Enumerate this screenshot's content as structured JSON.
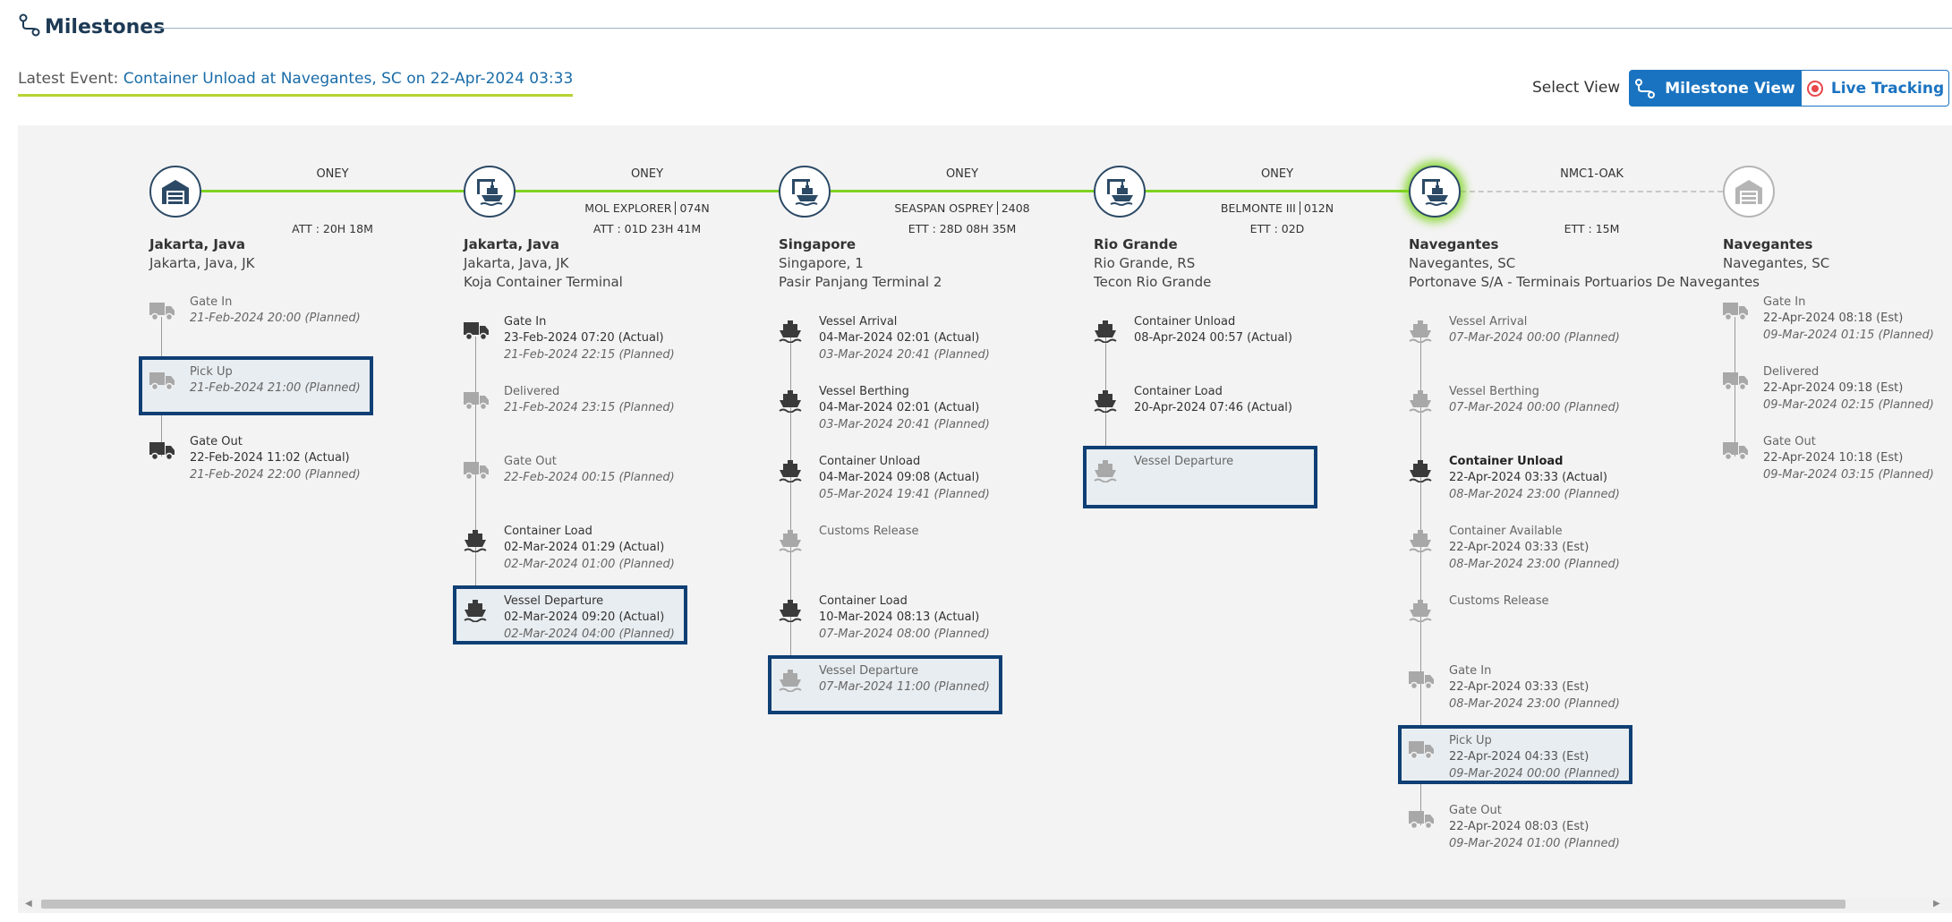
{
  "header": {
    "title": "Milestones",
    "icon": "route-icon"
  },
  "latest_event": {
    "label": "Latest Event:",
    "value": "Container Unload at Navegantes, SC on 22-Apr-2024 03:33"
  },
  "view_selector": {
    "label": "Select View",
    "milestone_label": "Milestone View",
    "live_label": "Live Tracking",
    "active": "Milestone View"
  },
  "colors": {
    "accent": "#1a73c0",
    "route_done": "#7ed321",
    "highlight_border": "#0f3f74",
    "node_border": "#2c4a66"
  },
  "legs": [
    {
      "carrier": "ONEY",
      "vessel": "",
      "voyage": "",
      "eta": "ATT : 20H 18M",
      "status": "done"
    },
    {
      "carrier": "ONEY",
      "vessel": "MOL EXPLORER",
      "voyage": "074N",
      "eta": "ATT : 01D 23H 41M",
      "status": "done"
    },
    {
      "carrier": "ONEY",
      "vessel": "SEASPAN OSPREY",
      "voyage": "2408",
      "eta": "ETT : 28D 08H 35M",
      "status": "done"
    },
    {
      "carrier": "ONEY",
      "vessel": "BELMONTE III",
      "voyage": "012N",
      "eta": "ETT : 02D",
      "status": "done"
    },
    {
      "carrier": "NMC1-OAK",
      "vessel": "",
      "voyage": "",
      "eta": "ETT : 15M",
      "status": "future"
    }
  ],
  "locations": [
    {
      "icon": "warehouse-icon",
      "state": "past",
      "name": "Jakarta, Java",
      "sub": "Jakarta, Java, JK",
      "terminal": "",
      "events": [
        {
          "icon": "truck-icon",
          "title": "Gate In",
          "lines": [
            "21-Feb-2024 20:00 (Planned)"
          ],
          "kind": "planned",
          "highlight": false
        },
        {
          "icon": "truck-icon",
          "title": "Pick Up",
          "lines": [
            "21-Feb-2024 21:00 (Planned)"
          ],
          "kind": "planned",
          "highlight": true
        },
        {
          "icon": "truck-icon",
          "title": "Gate Out",
          "lines": [
            "22-Feb-2024 11:02 (Actual)",
            "21-Feb-2024 22:00 (Planned)"
          ],
          "kind": "actual",
          "highlight": false
        }
      ]
    },
    {
      "icon": "crane-icon",
      "state": "past",
      "name": "Jakarta, Java",
      "sub": "Jakarta, Java, JK",
      "terminal": "Koja Container Terminal",
      "events": [
        {
          "icon": "truck-icon",
          "title": "Gate In",
          "lines": [
            "23-Feb-2024 07:20 (Actual)",
            "21-Feb-2024 22:15 (Planned)"
          ],
          "kind": "actual",
          "highlight": false
        },
        {
          "icon": "truck-icon",
          "title": "Delivered",
          "lines": [
            "21-Feb-2024 23:15 (Planned)"
          ],
          "kind": "planned",
          "highlight": false
        },
        {
          "icon": "truck-icon",
          "title": "Gate Out",
          "lines": [
            "22-Feb-2024 00:15 (Planned)"
          ],
          "kind": "planned",
          "highlight": false
        },
        {
          "icon": "ship-icon",
          "title": "Container Load",
          "lines": [
            "02-Mar-2024 01:29 (Actual)",
            "02-Mar-2024 01:00 (Planned)"
          ],
          "kind": "actual",
          "highlight": false
        },
        {
          "icon": "ship-icon",
          "title": "Vessel Departure",
          "lines": [
            "02-Mar-2024 09:20 (Actual)",
            "02-Mar-2024 04:00 (Planned)"
          ],
          "kind": "actual",
          "highlight": true
        }
      ]
    },
    {
      "icon": "crane-icon",
      "state": "past",
      "name": "Singapore",
      "sub": "Singapore, 1",
      "terminal": "Pasir Panjang Terminal 2",
      "events": [
        {
          "icon": "ship-icon",
          "title": "Vessel Arrival",
          "lines": [
            "04-Mar-2024 02:01 (Actual)",
            "03-Mar-2024 20:41 (Planned)"
          ],
          "kind": "actual",
          "highlight": false
        },
        {
          "icon": "ship-icon",
          "title": "Vessel Berthing",
          "lines": [
            "04-Mar-2024 02:01 (Actual)",
            "03-Mar-2024 20:41 (Planned)"
          ],
          "kind": "actual",
          "highlight": false
        },
        {
          "icon": "ship-icon",
          "title": "Container Unload",
          "lines": [
            "04-Mar-2024 09:08 (Actual)",
            "05-Mar-2024 19:41 (Planned)"
          ],
          "kind": "actual",
          "highlight": false
        },
        {
          "icon": "ship-icon",
          "title": "Customs Release",
          "lines": [],
          "kind": "planned",
          "highlight": false
        },
        {
          "icon": "ship-icon",
          "title": "Container Load",
          "lines": [
            "10-Mar-2024 08:13 (Actual)",
            "07-Mar-2024 08:00 (Planned)"
          ],
          "kind": "actual",
          "highlight": false
        },
        {
          "icon": "ship-icon",
          "title": "Vessel Departure",
          "lines": [
            "07-Mar-2024 11:00 (Planned)"
          ],
          "kind": "planned",
          "highlight": true
        }
      ]
    },
    {
      "icon": "crane-icon",
      "state": "past",
      "name": "Rio Grande",
      "sub": "Rio Grande, RS",
      "terminal": "Tecon Rio Grande",
      "events": [
        {
          "icon": "ship-icon",
          "title": "Container Unload",
          "lines": [
            "08-Apr-2024 00:57 (Actual)"
          ],
          "kind": "actual",
          "highlight": false
        },
        {
          "icon": "ship-icon",
          "title": "Container Load",
          "lines": [
            "20-Apr-2024 07:46 (Actual)"
          ],
          "kind": "actual",
          "highlight": false
        },
        {
          "icon": "ship-icon",
          "title": "Vessel Departure",
          "lines": [],
          "kind": "planned",
          "highlight": true
        }
      ]
    },
    {
      "icon": "crane-icon",
      "state": "current",
      "name": "Navegantes",
      "sub": "Navegantes, SC",
      "terminal": "Portonave S/A - Terminais Portuarios De Navegantes",
      "events": [
        {
          "icon": "ship-icon",
          "title": "Vessel Arrival",
          "lines": [
            "07-Mar-2024 00:00 (Planned)"
          ],
          "kind": "planned",
          "highlight": false
        },
        {
          "icon": "ship-icon",
          "title": "Vessel Berthing",
          "lines": [
            "07-Mar-2024 00:00 (Planned)"
          ],
          "kind": "planned",
          "highlight": false
        },
        {
          "icon": "ship-icon",
          "title": "Container Unload",
          "lines": [
            "22-Apr-2024 03:33 (Actual)",
            "08-Mar-2024 23:00 (Planned)"
          ],
          "kind": "current",
          "highlight": false
        },
        {
          "icon": "ship-icon",
          "title": "Container Available",
          "lines": [
            "22-Apr-2024 03:33 (Est)",
            "08-Mar-2024 23:00 (Planned)"
          ],
          "kind": "future",
          "highlight": false
        },
        {
          "icon": "ship-icon",
          "title": "Customs Release",
          "lines": [],
          "kind": "planned",
          "highlight": false
        },
        {
          "icon": "truck-icon",
          "title": "Gate In",
          "lines": [
            "22-Apr-2024 03:33 (Est)",
            "08-Mar-2024 23:00 (Planned)"
          ],
          "kind": "future",
          "highlight": false
        },
        {
          "icon": "truck-icon",
          "title": "Pick Up",
          "lines": [
            "22-Apr-2024 04:33 (Est)",
            "09-Mar-2024 00:00 (Planned)"
          ],
          "kind": "future",
          "highlight": true
        },
        {
          "icon": "truck-icon",
          "title": "Gate Out",
          "lines": [
            "22-Apr-2024 08:03 (Est)",
            "09-Mar-2024 01:00 (Planned)"
          ],
          "kind": "future",
          "highlight": false
        }
      ]
    },
    {
      "icon": "warehouse-icon",
      "state": "future",
      "name": "Navegantes",
      "sub": "Navegantes, SC",
      "terminal": "",
      "events": [
        {
          "icon": "truck-icon",
          "title": "Gate In",
          "lines": [
            "22-Apr-2024 08:18 (Est)",
            "09-Mar-2024 01:15 (Planned)"
          ],
          "kind": "future",
          "highlight": false
        },
        {
          "icon": "truck-icon",
          "title": "Delivered",
          "lines": [
            "22-Apr-2024 09:18 (Est)",
            "09-Mar-2024 02:15 (Planned)"
          ],
          "kind": "future",
          "highlight": false
        },
        {
          "icon": "truck-icon",
          "title": "Gate Out",
          "lines": [
            "22-Apr-2024 10:18 (Est)",
            "09-Mar-2024 03:15 (Planned)"
          ],
          "kind": "future",
          "highlight": false
        }
      ]
    }
  ]
}
